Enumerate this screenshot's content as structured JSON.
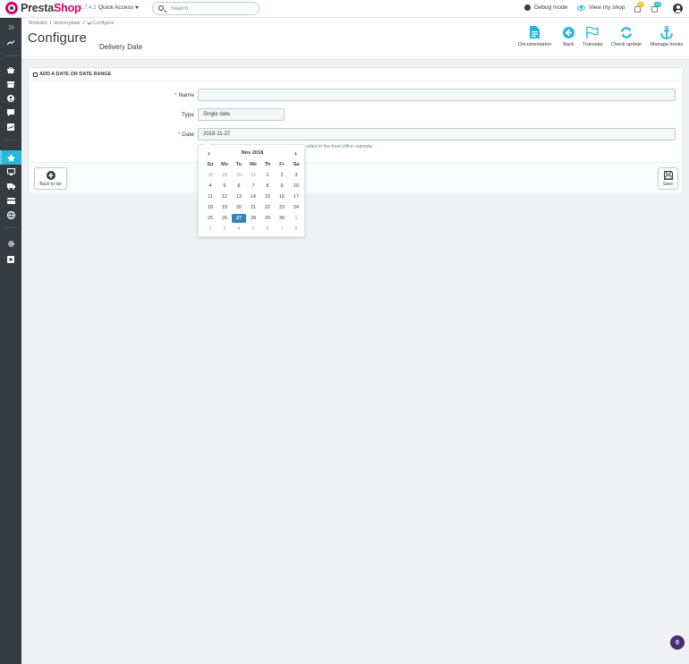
{
  "header": {
    "brand_presta": "Presta",
    "brand_shop": "Shop",
    "version": "1.7.4.2",
    "quick_access": "Quick Access",
    "search_placeholder": "Search",
    "debug_mode": "Debug mode",
    "view_shop": "View my shop",
    "notifications": [
      {
        "icon": "cart-icon",
        "count": "27",
        "color": "#fbbb22"
      },
      {
        "icon": "user-icon",
        "count": "13",
        "color": "#25b9d7"
      }
    ]
  },
  "breadcrumb": {
    "items": [
      "Modules",
      "deliverydate",
      "Configure"
    ]
  },
  "page": {
    "title": "Configure",
    "module_name": "Delivery Date"
  },
  "toolbar": {
    "buttons": [
      {
        "label": "Documentation",
        "icon": "book-icon"
      },
      {
        "label": "Back",
        "icon": "arrow-back-icon"
      },
      {
        "label": "Translate",
        "icon": "flag-icon"
      },
      {
        "label": "Check update",
        "icon": "refresh-icon"
      },
      {
        "label": "Manage hooks",
        "icon": "anchor-icon"
      }
    ]
  },
  "panel": {
    "heading": "ADD A DATE OR DATE RANGE",
    "fields": {
      "name_label": "Name",
      "name_value": "",
      "type_label": "Type",
      "type_value": "Single date",
      "date_label": "Date",
      "date_value": "2018-11-27",
      "help_text": "abled in the front-office calendar."
    },
    "footer": {
      "back_label": "Back to list",
      "save_label": "Save"
    }
  },
  "datepicker": {
    "month_label": "Nov 2018",
    "weekdays": [
      "Su",
      "Mo",
      "Tu",
      "We",
      "Th",
      "Fr",
      "Sa"
    ],
    "weeks": [
      [
        {
          "d": "28",
          "m": true
        },
        {
          "d": "29",
          "m": true
        },
        {
          "d": "30",
          "m": true
        },
        {
          "d": "31",
          "m": true
        },
        {
          "d": "1"
        },
        {
          "d": "2"
        },
        {
          "d": "3"
        }
      ],
      [
        {
          "d": "4"
        },
        {
          "d": "5"
        },
        {
          "d": "6"
        },
        {
          "d": "7"
        },
        {
          "d": "8"
        },
        {
          "d": "9"
        },
        {
          "d": "10"
        }
      ],
      [
        {
          "d": "11"
        },
        {
          "d": "12"
        },
        {
          "d": "13"
        },
        {
          "d": "14"
        },
        {
          "d": "15"
        },
        {
          "d": "16"
        },
        {
          "d": "17"
        }
      ],
      [
        {
          "d": "18"
        },
        {
          "d": "19"
        },
        {
          "d": "20"
        },
        {
          "d": "21"
        },
        {
          "d": "22"
        },
        {
          "d": "23"
        },
        {
          "d": "24"
        }
      ],
      [
        {
          "d": "25"
        },
        {
          "d": "26"
        },
        {
          "d": "27",
          "a": true
        },
        {
          "d": "28"
        },
        {
          "d": "29"
        },
        {
          "d": "30"
        },
        {
          "d": "1",
          "m": true
        }
      ],
      [
        {
          "d": "2",
          "m": true
        },
        {
          "d": "3",
          "m": true
        },
        {
          "d": "4",
          "m": true
        },
        {
          "d": "5",
          "m": true
        },
        {
          "d": "6",
          "m": true
        },
        {
          "d": "7",
          "m": true
        },
        {
          "d": "8",
          "m": true
        }
      ]
    ],
    "selected_color": "#3585b8"
  },
  "sidebar": {
    "items": [
      {
        "icon": "collapse-icon",
        "active": false
      },
      {
        "icon": "dashboard-icon",
        "active": false
      },
      {
        "icon": "orders-icon",
        "active": false
      },
      {
        "icon": "catalog-icon",
        "active": false
      },
      {
        "icon": "customers-icon",
        "active": false
      },
      {
        "icon": "customer-service-icon",
        "active": false
      },
      {
        "icon": "stats-icon",
        "active": false
      },
      {
        "icon": "modules-icon",
        "active": true
      },
      {
        "icon": "design-icon",
        "active": false
      },
      {
        "icon": "shipping-icon",
        "active": false
      },
      {
        "icon": "payment-icon",
        "active": false
      },
      {
        "icon": "international-icon",
        "active": false
      },
      {
        "icon": "settings-icon",
        "active": false
      },
      {
        "icon": "advanced-icon",
        "active": false
      }
    ]
  },
  "corner_badge": "0",
  "colors": {
    "accent": "#25b9d7",
    "brand": "#df0067",
    "sidebar": "#363a41"
  }
}
